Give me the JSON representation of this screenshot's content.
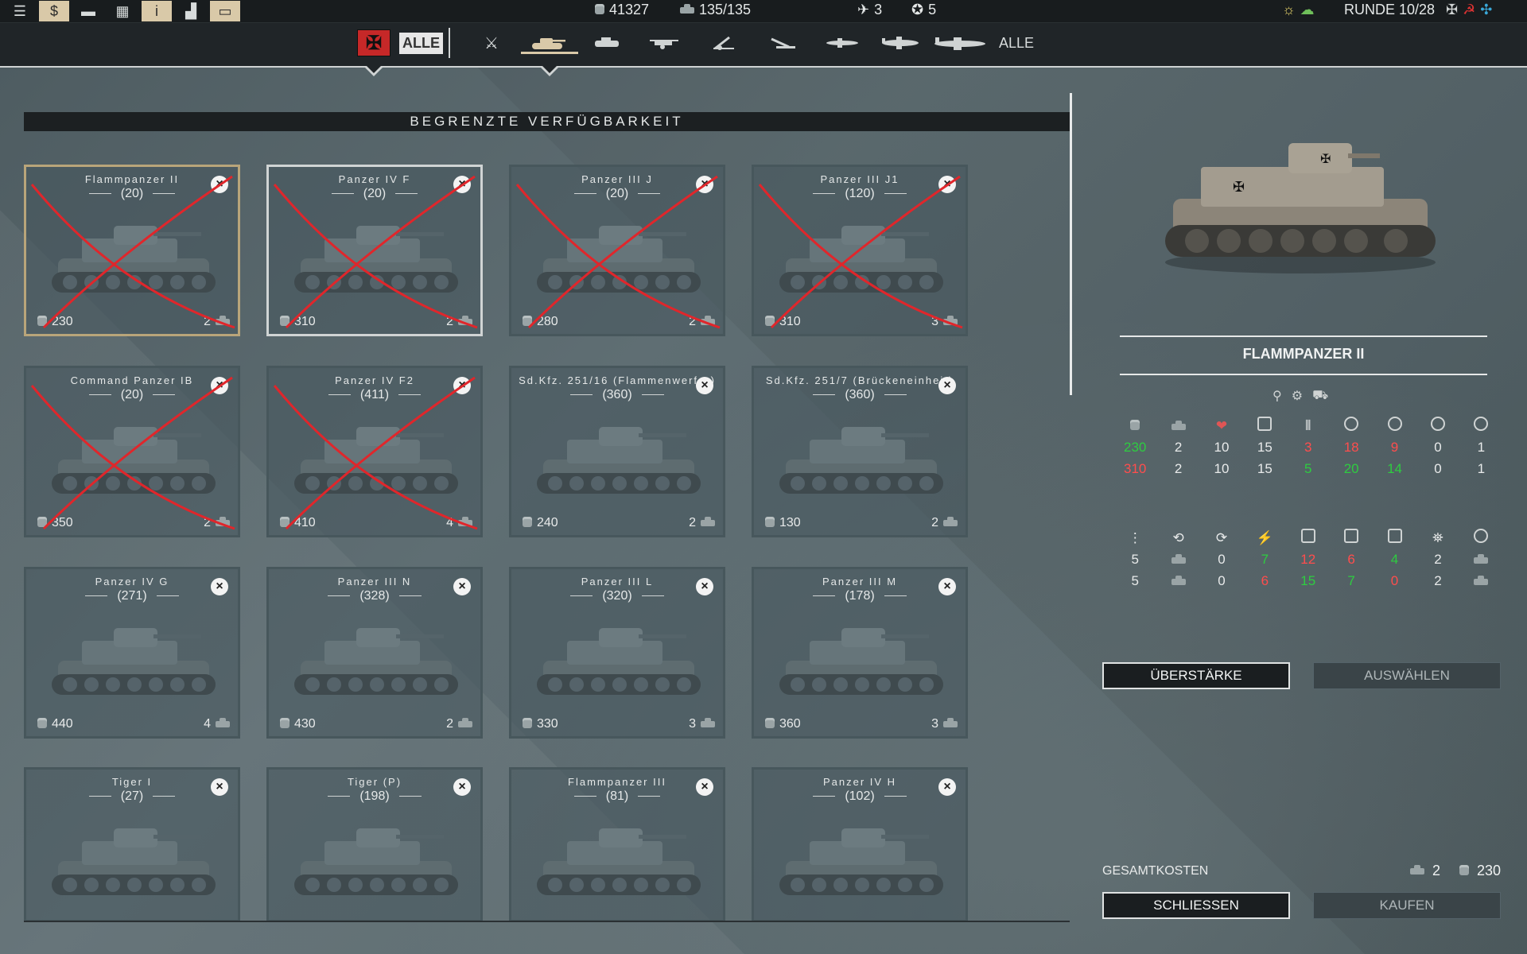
{
  "topbar": {
    "money": "41327",
    "units": "135/135",
    "aircraft": "3",
    "medals": "5",
    "round": "RUNDE 10/28"
  },
  "categories": {
    "flag_alle": "ALLE",
    "right_alle": "ALLE"
  },
  "banner": "BEGRENZTE VERFÜGBARKEIT",
  "cards": [
    {
      "name": "Flammpanzer II",
      "count": "(20)",
      "cost": "230",
      "slots": "2",
      "crossed": true
    },
    {
      "name": "Panzer IV F",
      "count": "(20)",
      "cost": "310",
      "slots": "2",
      "crossed": true
    },
    {
      "name": "Panzer III J",
      "count": "(20)",
      "cost": "280",
      "slots": "2",
      "crossed": true
    },
    {
      "name": "Panzer III J1",
      "count": "(120)",
      "cost": "310",
      "slots": "3",
      "crossed": true
    },
    {
      "name": "Command Panzer IB",
      "count": "(20)",
      "cost": "350",
      "slots": "2",
      "crossed": true
    },
    {
      "name": "Panzer IV F2",
      "count": "(411)",
      "cost": "410",
      "slots": "4",
      "crossed": true
    },
    {
      "name": "Sd.Kfz. 251/16 (Flammenwerfer)",
      "count": "(360)",
      "cost": "240",
      "slots": "2",
      "crossed": false
    },
    {
      "name": "Sd.Kfz. 251/7 (Brückeneinheit)",
      "count": "(360)",
      "cost": "130",
      "slots": "2",
      "crossed": false
    },
    {
      "name": "Panzer IV G",
      "count": "(271)",
      "cost": "440",
      "slots": "4",
      "crossed": false
    },
    {
      "name": "Panzer III N",
      "count": "(328)",
      "cost": "430",
      "slots": "2",
      "crossed": false
    },
    {
      "name": "Panzer III L",
      "count": "(320)",
      "cost": "330",
      "slots": "3",
      "crossed": false
    },
    {
      "name": "Panzer III M",
      "count": "(178)",
      "cost": "360",
      "slots": "3",
      "crossed": false
    },
    {
      "name": "Tiger I",
      "count": "(27)",
      "cost": "",
      "slots": "",
      "crossed": false
    },
    {
      "name": "Tiger (P)",
      "count": "(198)",
      "cost": "",
      "slots": "",
      "crossed": false
    },
    {
      "name": "Flammpanzer III",
      "count": "(81)",
      "cost": "",
      "slots": "",
      "crossed": false
    },
    {
      "name": "Panzer IV H",
      "count": "(102)",
      "cost": "",
      "slots": "",
      "crossed": false
    }
  ],
  "detail": {
    "name": "FLAMMPANZER II",
    "stats1": {
      "row1": [
        "230",
        "2",
        "10",
        "15",
        "3",
        "18",
        "9",
        "0",
        "1"
      ],
      "row1_colors": [
        "g",
        "y",
        "y",
        "y",
        "r",
        "r",
        "r",
        "y",
        "y"
      ],
      "row2": [
        "310",
        "2",
        "10",
        "15",
        "5",
        "20",
        "14",
        "0",
        "1"
      ],
      "row2_colors": [
        "r",
        "y",
        "y",
        "y",
        "g",
        "g",
        "g",
        "y",
        "y"
      ]
    },
    "stats2": {
      "row1": [
        "5",
        "",
        "0",
        "7",
        "12",
        "6",
        "4",
        "2",
        ""
      ],
      "row1_colors": [
        "y",
        "y",
        "y",
        "g",
        "r",
        "r",
        "g",
        "y",
        "y"
      ],
      "row2": [
        "5",
        "",
        "0",
        "6",
        "15",
        "7",
        "0",
        "2",
        ""
      ],
      "row2_colors": [
        "y",
        "y",
        "y",
        "r",
        "g",
        "g",
        "r",
        "y",
        "y"
      ]
    }
  },
  "buttons": {
    "ueberstaerke": "ÜBERSTÄRKE",
    "auswaehlen": "AUSWÄHLEN",
    "schliessen": "SCHLIESSEN",
    "kaufen": "KAUFEN"
  },
  "totals": {
    "label": "GESAMTKOSTEN",
    "slots": "2",
    "cost": "230"
  }
}
